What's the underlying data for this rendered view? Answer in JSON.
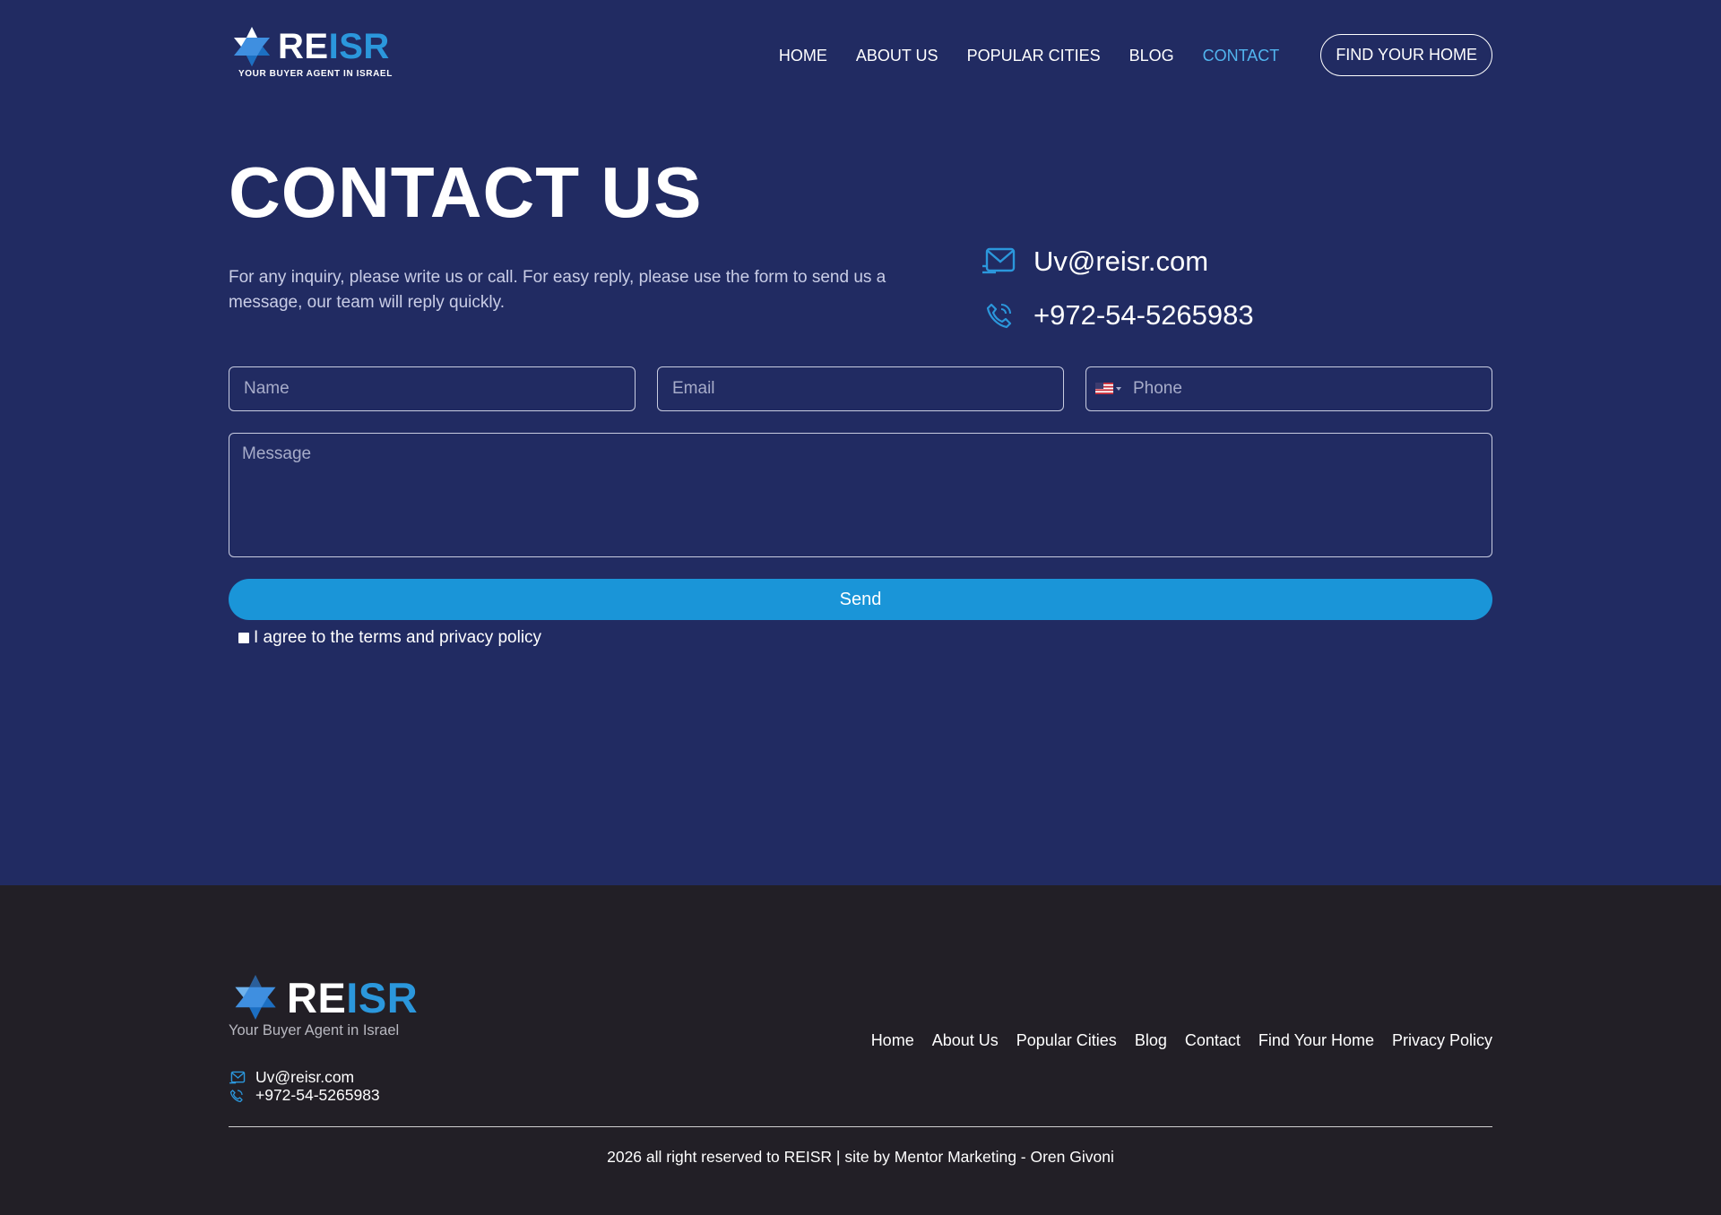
{
  "header": {
    "logo": {
      "brand_re": "RE",
      "brand_isr": "ISR",
      "tagline": "YOUR BUYER AGENT IN ISRAEL"
    },
    "nav": [
      {
        "label": "HOME"
      },
      {
        "label": "ABOUT US"
      },
      {
        "label": "POPULAR CITIES"
      },
      {
        "label": "BLOG"
      },
      {
        "label": "CONTACT",
        "active": true
      }
    ],
    "cta_label": "FIND YOUR HOME"
  },
  "main": {
    "title": "CONTACT US",
    "intro": "For any inquiry, please write us or call. For easy reply, please use the form to send us a message, our team will reply quickly.",
    "email": "Uv@reisr.com",
    "phone": "+972-54-5265983",
    "email_icon": "envelope-icon",
    "phone_icon": "phone-icon"
  },
  "form": {
    "name_placeholder": "Name",
    "email_placeholder": "Email",
    "phone_placeholder": "Phone",
    "message_placeholder": "Message",
    "send_label": "Send",
    "agree_label": "I agree to the terms and privacy policy",
    "country_flag": "us-flag-icon"
  },
  "footer": {
    "logo": {
      "brand_re": "RE",
      "brand_isr": "ISR",
      "tagline": "Your Buyer Agent in Israel"
    },
    "email": "Uv@reisr.com",
    "phone": "+972-54-5265983",
    "nav": [
      {
        "label": "Home"
      },
      {
        "label": "About Us"
      },
      {
        "label": "Popular Cities"
      },
      {
        "label": "Blog"
      },
      {
        "label": "Contact"
      },
      {
        "label": "Find Your Home"
      },
      {
        "label": "Privacy Policy"
      }
    ],
    "copyright": "2026 all right reserved to REISR | site by Mentor Marketing - Oren Givoni"
  },
  "colors": {
    "main_bg": "#212b62",
    "footer_bg": "#221f26",
    "accent": "#1a95d8",
    "active_nav": "#52b5ef"
  }
}
